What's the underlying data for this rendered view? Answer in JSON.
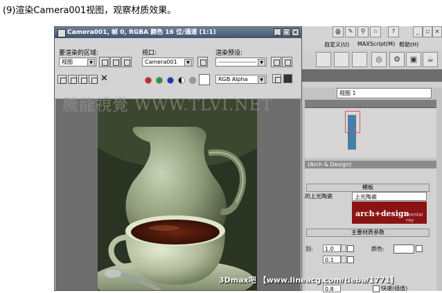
{
  "caption": "(9)渲染Camera001视图，观察材质效果。",
  "render_window": {
    "title": "Camera001, 帧 0, RGBA 颜色 16 位/通道 (1:1)",
    "area_label": "要渲染的区域:",
    "area_value": "视图",
    "viewport_label": "视口:",
    "viewport_value": "Camera001",
    "preset_label": "渲染预设:",
    "preset_value": "-------------------",
    "channel_value": "RGB Alpha"
  },
  "max_ui": {
    "menu": [
      "自定义(U)",
      "MAXScript(M)",
      "帮助(H)"
    ],
    "viewport_dropdown": "视图 1",
    "rollout_title": "(Arch & Design)",
    "templates_title": "模板",
    "preset_left": "的上光陶瓷",
    "preset_value": "上光陶瓷",
    "banner_brand": "arch+design",
    "banner_sub": "mental ray",
    "main_params_title": "主要材质参数",
    "level_label": "别:",
    "level_value": "1.0",
    "second_value": "0.1",
    "color_label": "颜色:",
    "fast_label": "快速(插值)",
    "bottom_value": "0.8"
  },
  "watermark": "騰龍視覺 WWW.TLVI.NET",
  "footer": "3Dmax吧 【www.lineacg.com/tieba/1771】",
  "colors": {
    "title_bar": "#3f5570",
    "banner": "#8a1414",
    "preview_blue": "#4a7ea6"
  }
}
